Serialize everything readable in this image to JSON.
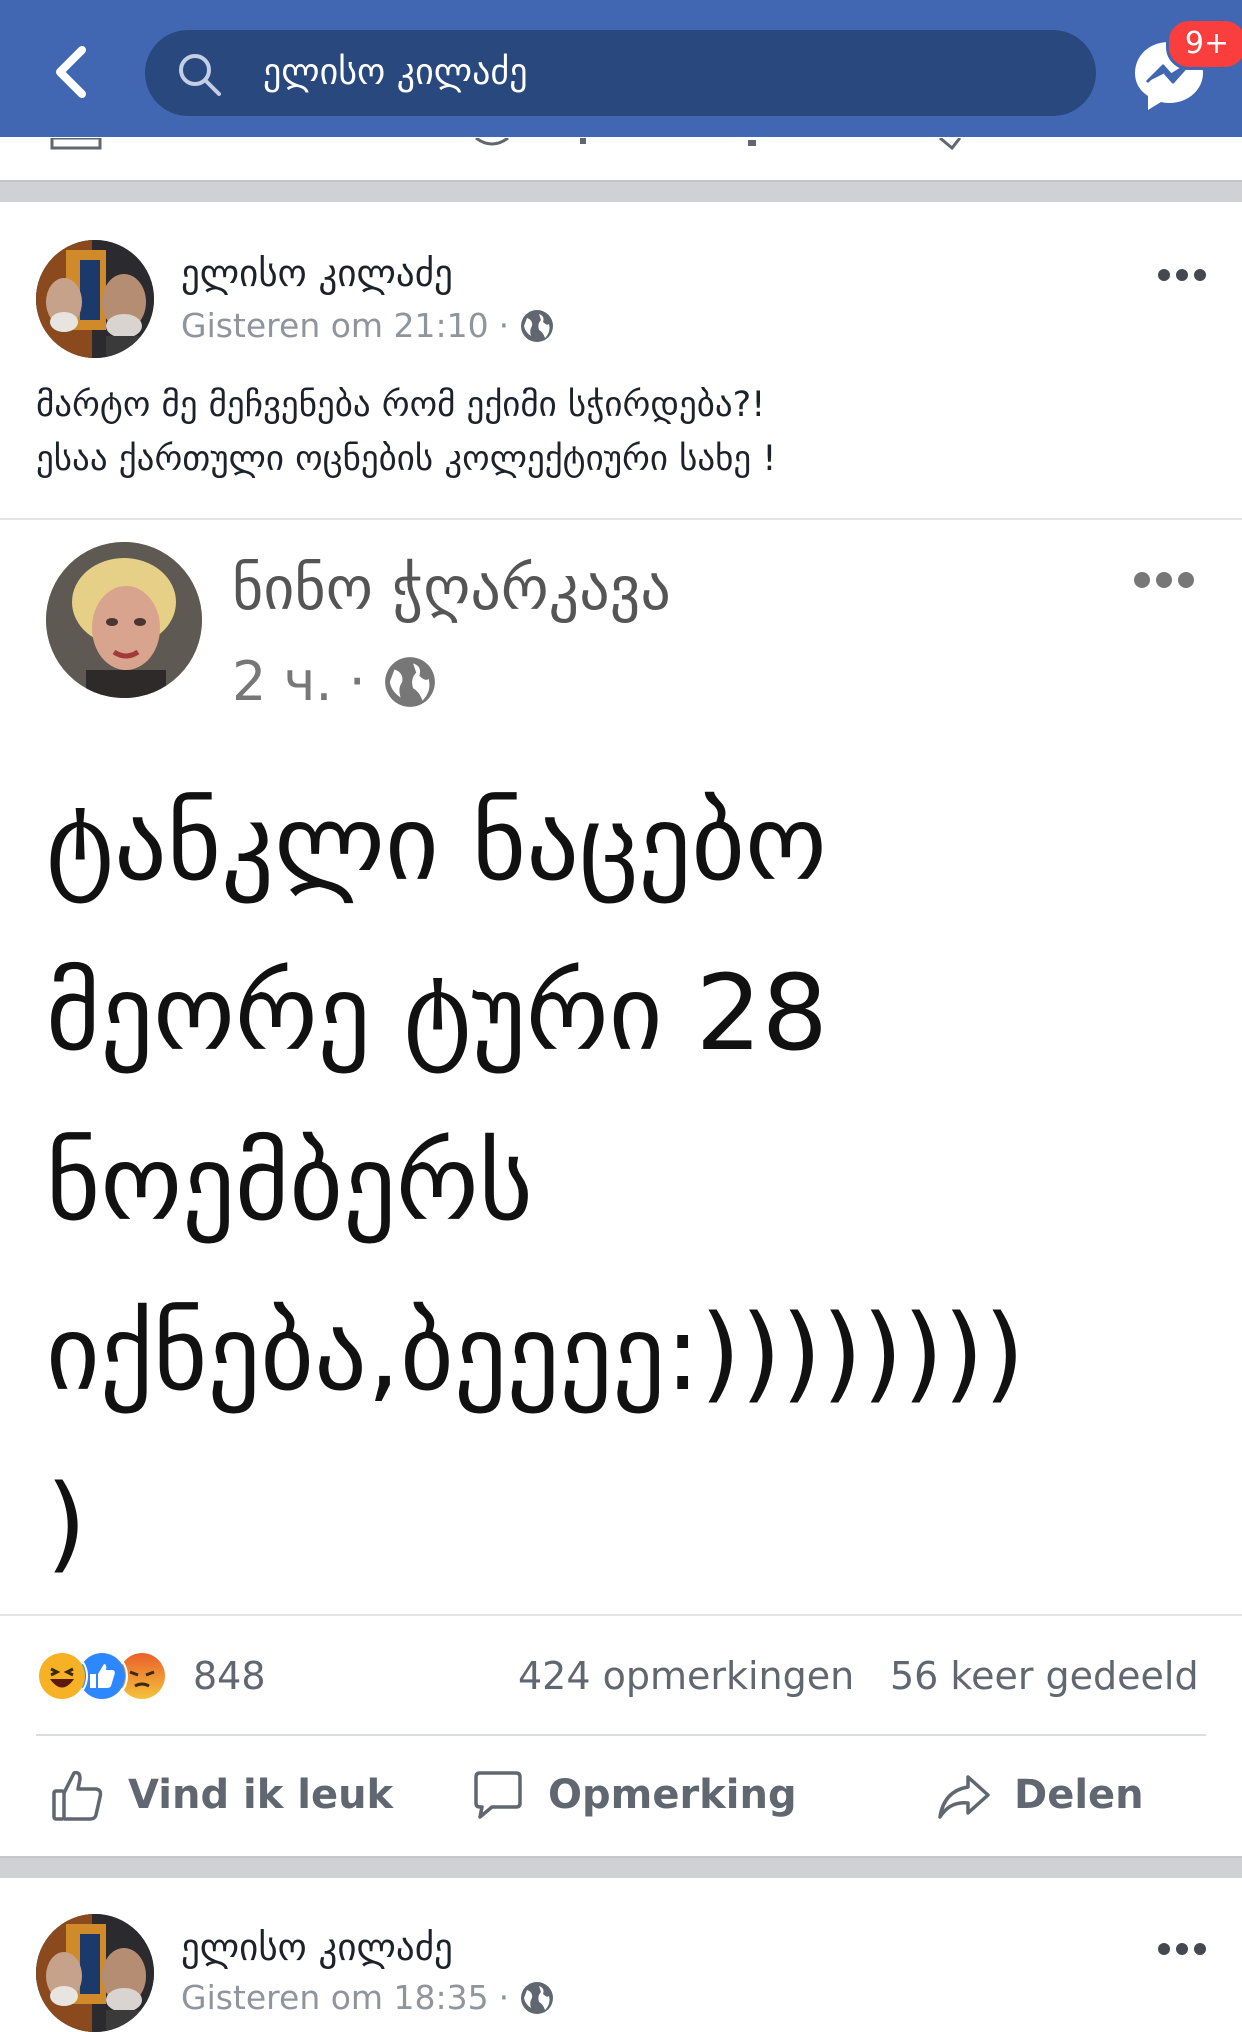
{
  "header": {
    "search_value": "ელისო კილაძე",
    "messenger_badge": "9+",
    "colors": {
      "bar": "#4267b2",
      "search_bg": "#29487d",
      "badge": "#fa3e3e"
    }
  },
  "posts": [
    {
      "author": "ელისო კილაძე",
      "time": "Gisteren om 21:10",
      "dot": "·",
      "privacy_icon": "globe-icon",
      "text_lines": [
        "მარტო მე მეჩვენება რომ ექიმი სჭირდება?!",
        "ესაა ქართული ოცნების კოლექტიური სახე !"
      ],
      "shared_image": {
        "author": "ნინო ჭღარკავა",
        "time": "2 ч.",
        "dot": "·",
        "big_text_lines": [
          "ტანკლი ნაცებო",
          "მეორე ტური 28",
          "ნოემბერს",
          "იქნება,ბეეეე:))))))))",
          ")"
        ]
      },
      "reactions": {
        "icons": [
          "haha-icon",
          "like-icon",
          "angry-icon"
        ],
        "count": "848",
        "comments": "424 opmerkingen",
        "shares": "56 keer gedeeld"
      },
      "actions": {
        "like": "Vind ik leuk",
        "comment": "Opmerking",
        "share": "Delen"
      }
    },
    {
      "author": "ელისო კილაძე",
      "time": "Gisteren om 18:35",
      "dot": "·",
      "privacy_icon": "globe-icon"
    }
  ]
}
